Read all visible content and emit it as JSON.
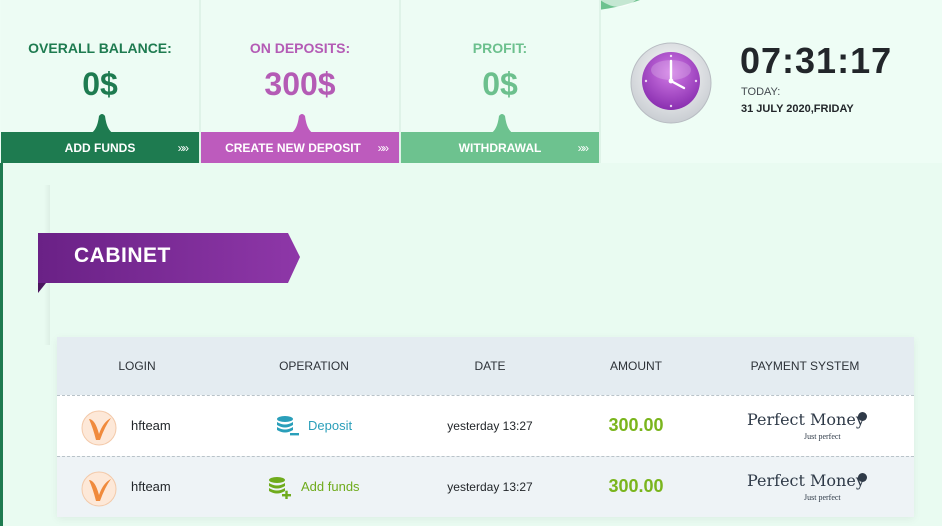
{
  "stats": [
    {
      "label": "OVERALL BALANCE:",
      "value": "0$",
      "button": "ADD FUNDS",
      "chevrons": "»»",
      "label_color": "#1e7b50",
      "value_color": "#1e7b50",
      "button_color": "#1e7b50"
    },
    {
      "label": "ON DEPOSITS:",
      "value": "300$",
      "button": "CREATE NEW DEPOSIT",
      "chevrons": "»»",
      "label_color": "#b45bb5",
      "value_color": "#b45bb5",
      "button_color": "#bd5bbd"
    },
    {
      "label": "PROFIT:",
      "value": "0$",
      "button": "WITHDRAWAL",
      "chevrons": "»»",
      "label_color": "#6cc08d",
      "value_color": "#6cc08d",
      "button_color": "#6dc28f"
    }
  ],
  "clock": {
    "time": "07:31:17",
    "today_label": "TODAY:",
    "date": "31 JULY 2020,FRIDAY",
    "icon": "clock-icon"
  },
  "cabinet": {
    "title": "CABINET",
    "ribbon_color": "#7b2d94"
  },
  "table": {
    "headers": [
      "LOGIN",
      "OPERATION",
      "DATE",
      "AMOUNT",
      "PAYMENT SYSTEM"
    ],
    "rows": [
      {
        "login": "hfteam",
        "operation": "Deposit",
        "operation_color": "#2a9fba",
        "operation_icon": "coins-minus-icon",
        "date": "yesterday 13:27",
        "amount": "300.00",
        "payment_system": "Perfect Money",
        "payment_sub": "Just perfect"
      },
      {
        "login": "hfteam",
        "operation": "Add funds",
        "operation_color": "#6fab1c",
        "operation_icon": "coins-plus-icon",
        "date": "yesterday 13:27",
        "amount": "300.00",
        "payment_system": "Perfect Money",
        "payment_sub": "Just perfect"
      }
    ]
  }
}
